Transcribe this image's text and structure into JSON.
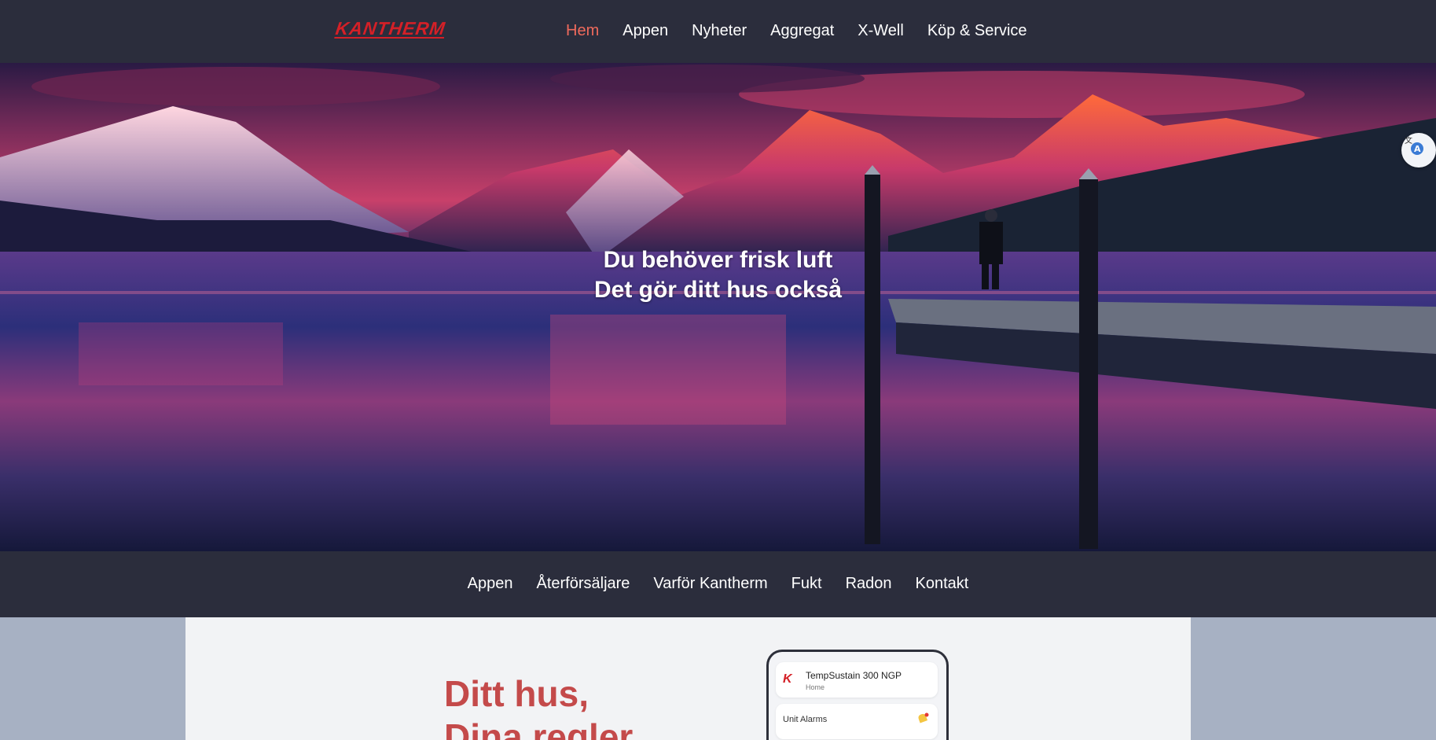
{
  "brand": {
    "logo_text": "KANTHERM",
    "accent": "#ef6a5c",
    "brand_red": "#d42027"
  },
  "topnav": {
    "items": [
      {
        "label": "Hem",
        "active": true
      },
      {
        "label": "Appen"
      },
      {
        "label": "Nyheter"
      },
      {
        "label": "Aggregat"
      },
      {
        "label": "X-Well"
      },
      {
        "label": "Köp & Service"
      }
    ]
  },
  "hero": {
    "line1": "Du behöver frisk luft",
    "line2": "Det gör ditt hus också",
    "translate_icon": "translate-icon"
  },
  "subnav": {
    "items": [
      {
        "label": "Appen"
      },
      {
        "label": "Återförsäljare"
      },
      {
        "label": "Varför Kantherm"
      },
      {
        "label": "Fukt"
      },
      {
        "label": "Radon"
      },
      {
        "label": "Kontakt"
      }
    ]
  },
  "content": {
    "headline_line1": "Ditt hus,",
    "headline_line2": "Dina regler",
    "phone": {
      "logo": "K",
      "device_name": "TempSustain 300 NGP",
      "device_location": "Home",
      "alarms_label": "Unit Alarms",
      "alarm_icon": "bell-icon"
    }
  }
}
